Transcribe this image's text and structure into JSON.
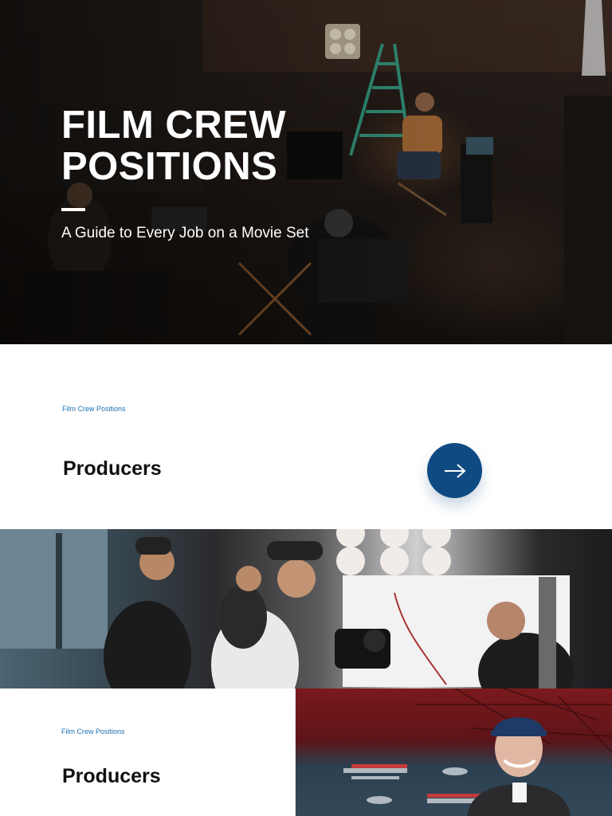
{
  "hero": {
    "title": "FILM CREW POSITIONS",
    "subtitle": "A Guide to Every Job on a Movie Set",
    "image_description": "film crew on a warehouse movie set"
  },
  "cards": [
    {
      "kicker": "Film Crew Positions",
      "title": "Producers",
      "action_icon": "arrow-right-icon"
    },
    {
      "kicker": "Film Crew Positions",
      "title": "Producers"
    }
  ],
  "photo_strip": {
    "image_description": "camera crew operating equipment in a studio"
  },
  "premiere_photo": {
    "image_description": "producer at a Spider-Man: Far From Home premiere"
  },
  "colors": {
    "accent": "#0f4a82",
    "kicker": "#1a6fb0",
    "title": "#111111",
    "hero_text": "#ffffff"
  }
}
